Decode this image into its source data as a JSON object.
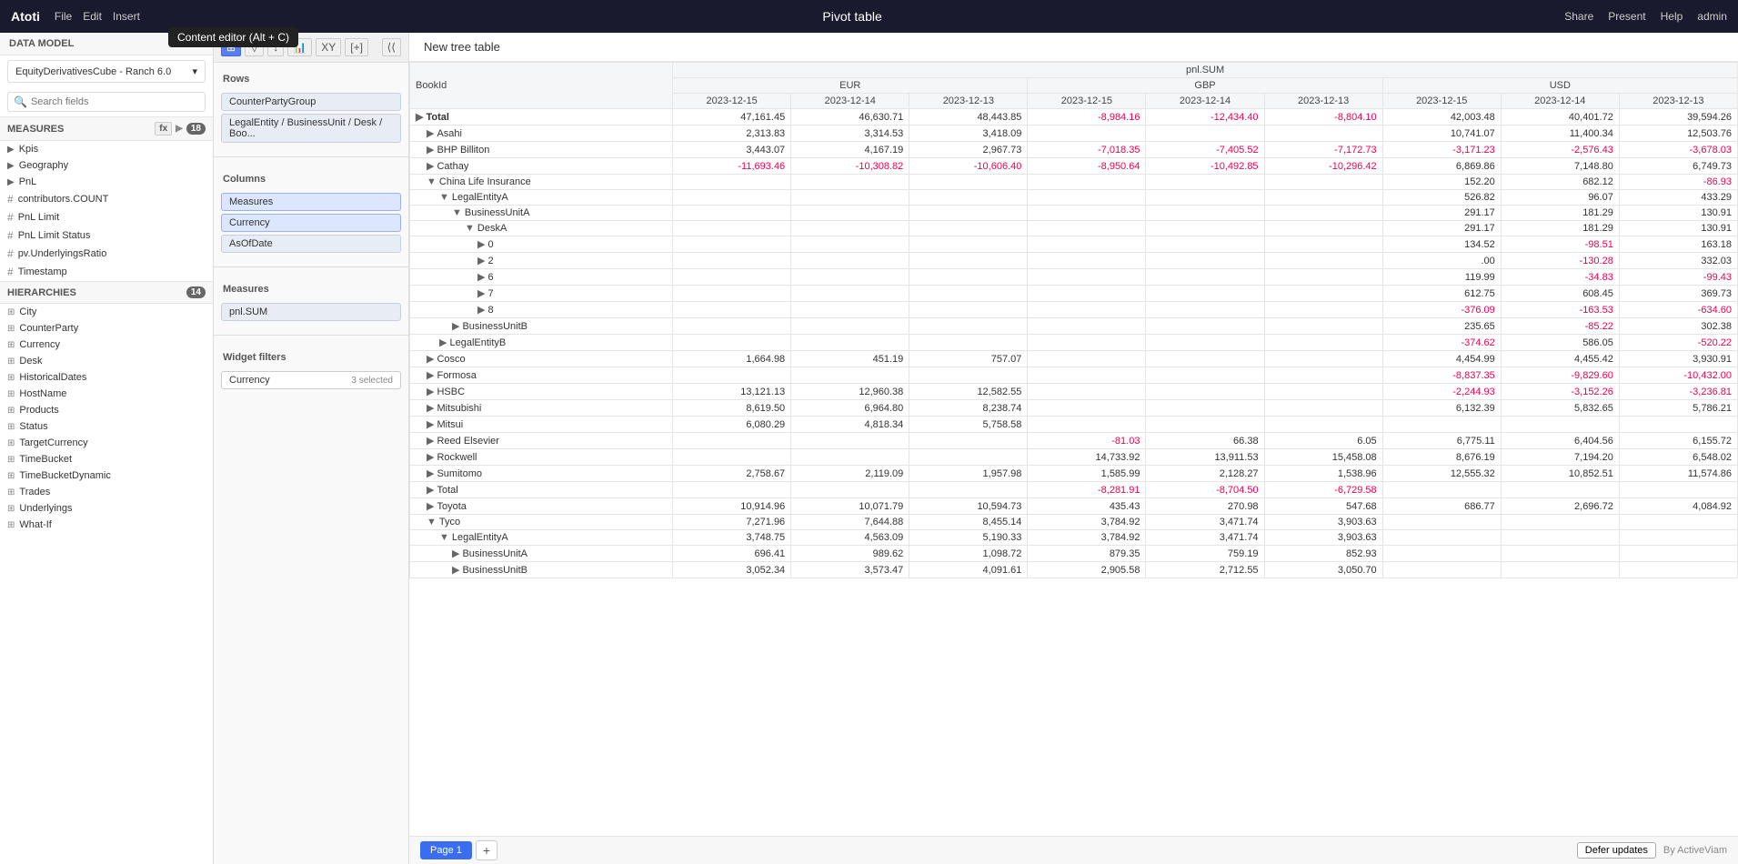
{
  "topbar": {
    "logo": "Atoti",
    "menu": [
      "File",
      "Edit",
      "Insert"
    ],
    "title": "Pivot table",
    "actions": [
      "Share",
      "Present",
      "Help",
      "admin"
    ]
  },
  "tooltip": "Content editor (Alt + C)",
  "sidebar": {
    "data_model_label": "DATA MODEL",
    "cube_name": "EquityDerivativesCube - Ranch 6.0",
    "search_placeholder": "Search fields",
    "measures_label": "MEASURES",
    "measures_count": "18",
    "measures_items": [
      {
        "type": "group",
        "icon": "▶",
        "label": "Kpis"
      },
      {
        "type": "group",
        "icon": "▶",
        "label": "Geography"
      },
      {
        "type": "group",
        "icon": "▶",
        "label": "PnL"
      },
      {
        "type": "hash",
        "label": "contributors.COUNT"
      },
      {
        "type": "hash",
        "label": "PnL Limit"
      },
      {
        "type": "hash",
        "label": "PnL Limit Status"
      },
      {
        "type": "hash",
        "label": "pv.UnderlyingsRatio"
      },
      {
        "type": "hash",
        "label": "Timestamp"
      }
    ],
    "hierarchies_label": "HIERARCHIES",
    "hierarchies_count": "14",
    "hierarchies_items": [
      "City",
      "CounterParty",
      "Currency",
      "Desk",
      "HistoricalDates",
      "HostName",
      "Products",
      "Status",
      "TargetCurrency",
      "TimeBucket",
      "TimeBucketDynamic",
      "Trades",
      "Underlyings",
      "What-If"
    ]
  },
  "config": {
    "rows_label": "Rows",
    "row_items": [
      "CounterPartyGroup",
      "LegalEntity / BusinessUnit / Desk / Boo..."
    ],
    "columns_label": "Columns",
    "column_items": [
      "Measures",
      "Currency",
      "AsOfDate"
    ],
    "measures_label": "Measures",
    "measures_items": [
      "pnl.SUM"
    ],
    "widget_filters_label": "Widget filters",
    "filter_items": [
      {
        "label": "Currency",
        "value": "3 selected"
      }
    ]
  },
  "table": {
    "title": "New tree table",
    "col_header_1": "BookId",
    "col_header_2": "pnl.SUM",
    "currency_eur": "EUR",
    "currency_gbp": "GBP",
    "currency_usd": "USD",
    "dates_eur": [
      "2023-12-15",
      "2023-12-14",
      "2023-12-13"
    ],
    "dates_gbp": [
      "2023-12-15",
      "2023-12-14",
      "2023-12-13"
    ],
    "dates_usd": [
      "2023-12-15",
      "2023-12-14",
      "2023-12-13"
    ],
    "rows": [
      {
        "label": "Total",
        "indent": 0,
        "bold": true,
        "expanded": false,
        "eur": [
          "47,161.45",
          "46,630.71",
          "48,443.85"
        ],
        "gbp": [
          "-8,984.16",
          "-12,434.40",
          "-8,804.10"
        ],
        "usd": [
          "42,003.48",
          "40,401.72",
          "39,594.26"
        ]
      },
      {
        "label": "Asahi",
        "indent": 1,
        "bold": false,
        "expanded": false,
        "eur": [
          "2,313.83",
          "3,314.53",
          "3,418.09"
        ],
        "gbp": [
          "",
          "",
          ""
        ],
        "usd": [
          "10,741.07",
          "11,400.34",
          "12,503.76"
        ]
      },
      {
        "label": "BHP Billiton",
        "indent": 1,
        "bold": false,
        "expanded": false,
        "eur": [
          "3,443.07",
          "4,167.19",
          "2,967.73"
        ],
        "gbp": [
          "-7,018.35",
          "-7,405.52",
          "-7,172.73"
        ],
        "usd": [
          "-3,171.23",
          "-2,576.43",
          "-3,678.03"
        ]
      },
      {
        "label": "Cathay",
        "indent": 1,
        "bold": false,
        "expanded": false,
        "eur": [
          "-11,693.46",
          "-10,308.82",
          "-10,606.40"
        ],
        "gbp": [
          "-8,950.64",
          "-10,492.85",
          "-10,296.42"
        ],
        "usd": [
          "6,869.86",
          "7,148.80",
          "6,749.73"
        ]
      },
      {
        "label": "China Life Insurance",
        "indent": 1,
        "bold": false,
        "expanded": true,
        "eur": [
          "",
          "",
          ""
        ],
        "gbp": [
          "",
          "",
          ""
        ],
        "usd": [
          "152.20",
          "682.12",
          "-86.93"
        ]
      },
      {
        "label": "LegalEntityA",
        "indent": 2,
        "bold": false,
        "expanded": true,
        "eur": [
          "",
          "",
          ""
        ],
        "gbp": [
          "",
          "",
          ""
        ],
        "usd": [
          "526.82",
          "96.07",
          "433.29"
        ]
      },
      {
        "label": "BusinessUnitA",
        "indent": 3,
        "bold": false,
        "expanded": true,
        "eur": [
          "",
          "",
          ""
        ],
        "gbp": [
          "",
          "",
          ""
        ],
        "usd": [
          "291.17",
          "181.29",
          "130.91"
        ]
      },
      {
        "label": "DeskA",
        "indent": 4,
        "bold": false,
        "expanded": true,
        "eur": [
          "",
          "",
          ""
        ],
        "gbp": [
          "",
          "",
          ""
        ],
        "usd": [
          "291.17",
          "181.29",
          "130.91"
        ]
      },
      {
        "label": "0",
        "indent": 5,
        "bold": false,
        "expanded": false,
        "eur": [
          "",
          "",
          ""
        ],
        "gbp": [
          "",
          "",
          ""
        ],
        "usd": [
          "134.52",
          "-98.51",
          "163.18"
        ]
      },
      {
        "label": "2",
        "indent": 5,
        "bold": false,
        "expanded": false,
        "eur": [
          "",
          "",
          ""
        ],
        "gbp": [
          "",
          "",
          ""
        ],
        "usd": [
          ".00",
          "-130.28",
          "332.03"
        ]
      },
      {
        "label": "6",
        "indent": 5,
        "bold": false,
        "expanded": false,
        "eur": [
          "",
          "",
          ""
        ],
        "gbp": [
          "",
          "",
          ""
        ],
        "usd": [
          "119.99",
          "-34.83",
          "-99.43"
        ]
      },
      {
        "label": "7",
        "indent": 5,
        "bold": false,
        "expanded": false,
        "eur": [
          "",
          "",
          ""
        ],
        "gbp": [
          "",
          "",
          ""
        ],
        "usd": [
          "612.75",
          "608.45",
          "369.73"
        ]
      },
      {
        "label": "8",
        "indent": 5,
        "bold": false,
        "expanded": false,
        "eur": [
          "",
          "",
          ""
        ],
        "gbp": [
          "",
          "",
          ""
        ],
        "usd": [
          "-376.09",
          "-163.53",
          "-634.60"
        ]
      },
      {
        "label": "BusinessUnitB",
        "indent": 3,
        "bold": false,
        "expanded": false,
        "eur": [
          "",
          "",
          ""
        ],
        "gbp": [
          "",
          "",
          ""
        ],
        "usd": [
          "235.65",
          "-85.22",
          "302.38"
        ]
      },
      {
        "label": "LegalEntityB",
        "indent": 2,
        "bold": false,
        "expanded": false,
        "eur": [
          "",
          "",
          ""
        ],
        "gbp": [
          "",
          "",
          ""
        ],
        "usd": [
          "-374.62",
          "586.05",
          "-520.22"
        ]
      },
      {
        "label": "Cosco",
        "indent": 1,
        "bold": false,
        "expanded": false,
        "eur": [
          "1,664.98",
          "451.19",
          "757.07"
        ],
        "gbp": [
          "",
          "",
          ""
        ],
        "usd": [
          "4,454.99",
          "4,455.42",
          "3,930.91"
        ]
      },
      {
        "label": "Formosa",
        "indent": 1,
        "bold": false,
        "expanded": false,
        "eur": [
          "",
          "",
          ""
        ],
        "gbp": [
          "",
          "",
          ""
        ],
        "usd": [
          "-8,837.35",
          "-9,829.60",
          "-10,432.00"
        ]
      },
      {
        "label": "HSBC",
        "indent": 1,
        "bold": false,
        "expanded": false,
        "eur": [
          "13,121.13",
          "12,960.38",
          "12,582.55"
        ],
        "gbp": [
          "",
          "",
          ""
        ],
        "usd": [
          "-2,244.93",
          "-3,152.26",
          "-3,236.81"
        ]
      },
      {
        "label": "Mitsubishi",
        "indent": 1,
        "bold": false,
        "expanded": false,
        "eur": [
          "8,619.50",
          "6,964.80",
          "8,238.74"
        ],
        "gbp": [
          "",
          "",
          ""
        ],
        "usd": [
          "6,132.39",
          "5,832.65",
          "5,786.21"
        ]
      },
      {
        "label": "Mitsui",
        "indent": 1,
        "bold": false,
        "expanded": false,
        "eur": [
          "6,080.29",
          "4,818.34",
          "5,758.58"
        ],
        "gbp": [
          "",
          "",
          ""
        ],
        "usd": [
          "",
          "",
          ""
        ]
      },
      {
        "label": "Reed Elsevier",
        "indent": 1,
        "bold": false,
        "expanded": false,
        "eur": [
          "",
          "",
          ""
        ],
        "gbp": [
          "-81.03",
          "66.38",
          "6.05"
        ],
        "usd": [
          "6,775.11",
          "6,404.56",
          "6,155.72"
        ]
      },
      {
        "label": "Rockwell",
        "indent": 1,
        "bold": false,
        "expanded": false,
        "eur": [
          "",
          "",
          ""
        ],
        "gbp": [
          "14,733.92",
          "13,911.53",
          "15,458.08"
        ],
        "usd": [
          "8,676.19",
          "7,194.20",
          "6,548.02"
        ]
      },
      {
        "label": "Sumitomo",
        "indent": 1,
        "bold": false,
        "expanded": false,
        "eur": [
          "2,758.67",
          "2,119.09",
          "1,957.98"
        ],
        "gbp": [
          "1,585.99",
          "2,128.27",
          "1,538.96"
        ],
        "usd": [
          "12,555.32",
          "10,852.51",
          "11,574.86"
        ]
      },
      {
        "label": "Total",
        "indent": 1,
        "bold": false,
        "expanded": false,
        "eur": [
          "",
          "",
          ""
        ],
        "gbp": [
          "-8,281.91",
          "-8,704.50",
          "-6,729.58"
        ],
        "usd": [
          "",
          "",
          ""
        ]
      },
      {
        "label": "Toyota",
        "indent": 1,
        "bold": false,
        "expanded": false,
        "eur": [
          "10,914.96",
          "10,071.79",
          "10,594.73"
        ],
        "gbp": [
          "435.43",
          "270.98",
          "547.68"
        ],
        "usd": [
          "686.77",
          "2,696.72",
          "4,084.92"
        ]
      },
      {
        "label": "Tyco",
        "indent": 1,
        "bold": false,
        "expanded": true,
        "eur": [
          "7,271.96",
          "7,644.88",
          "8,455.14"
        ],
        "gbp": [
          "3,784.92",
          "3,471.74",
          "3,903.63"
        ],
        "usd": [
          "",
          "",
          ""
        ]
      },
      {
        "label": "LegalEntityA",
        "indent": 2,
        "bold": false,
        "expanded": true,
        "eur": [
          "3,748.75",
          "4,563.09",
          "5,190.33"
        ],
        "gbp": [
          "3,784.92",
          "3,471.74",
          "3,903.63"
        ],
        "usd": [
          "",
          "",
          ""
        ]
      },
      {
        "label": "BusinessUnitA",
        "indent": 3,
        "bold": false,
        "expanded": false,
        "eur": [
          "696.41",
          "989.62",
          "1,098.72"
        ],
        "gbp": [
          "879.35",
          "759.19",
          "852.93"
        ],
        "usd": [
          "",
          "",
          ""
        ]
      },
      {
        "label": "BusinessUnitB",
        "indent": 3,
        "bold": false,
        "expanded": false,
        "eur": [
          "3,052.34",
          "3,573.47",
          "4,091.61"
        ],
        "gbp": [
          "2,905.58",
          "2,712.55",
          "3,050.70"
        ],
        "usd": [
          "",
          "",
          ""
        ]
      }
    ]
  },
  "bottom": {
    "page_label": "Page 1",
    "add_page": "+",
    "defer_label": "Defer updates",
    "active_vim": "By ActiveViam"
  }
}
